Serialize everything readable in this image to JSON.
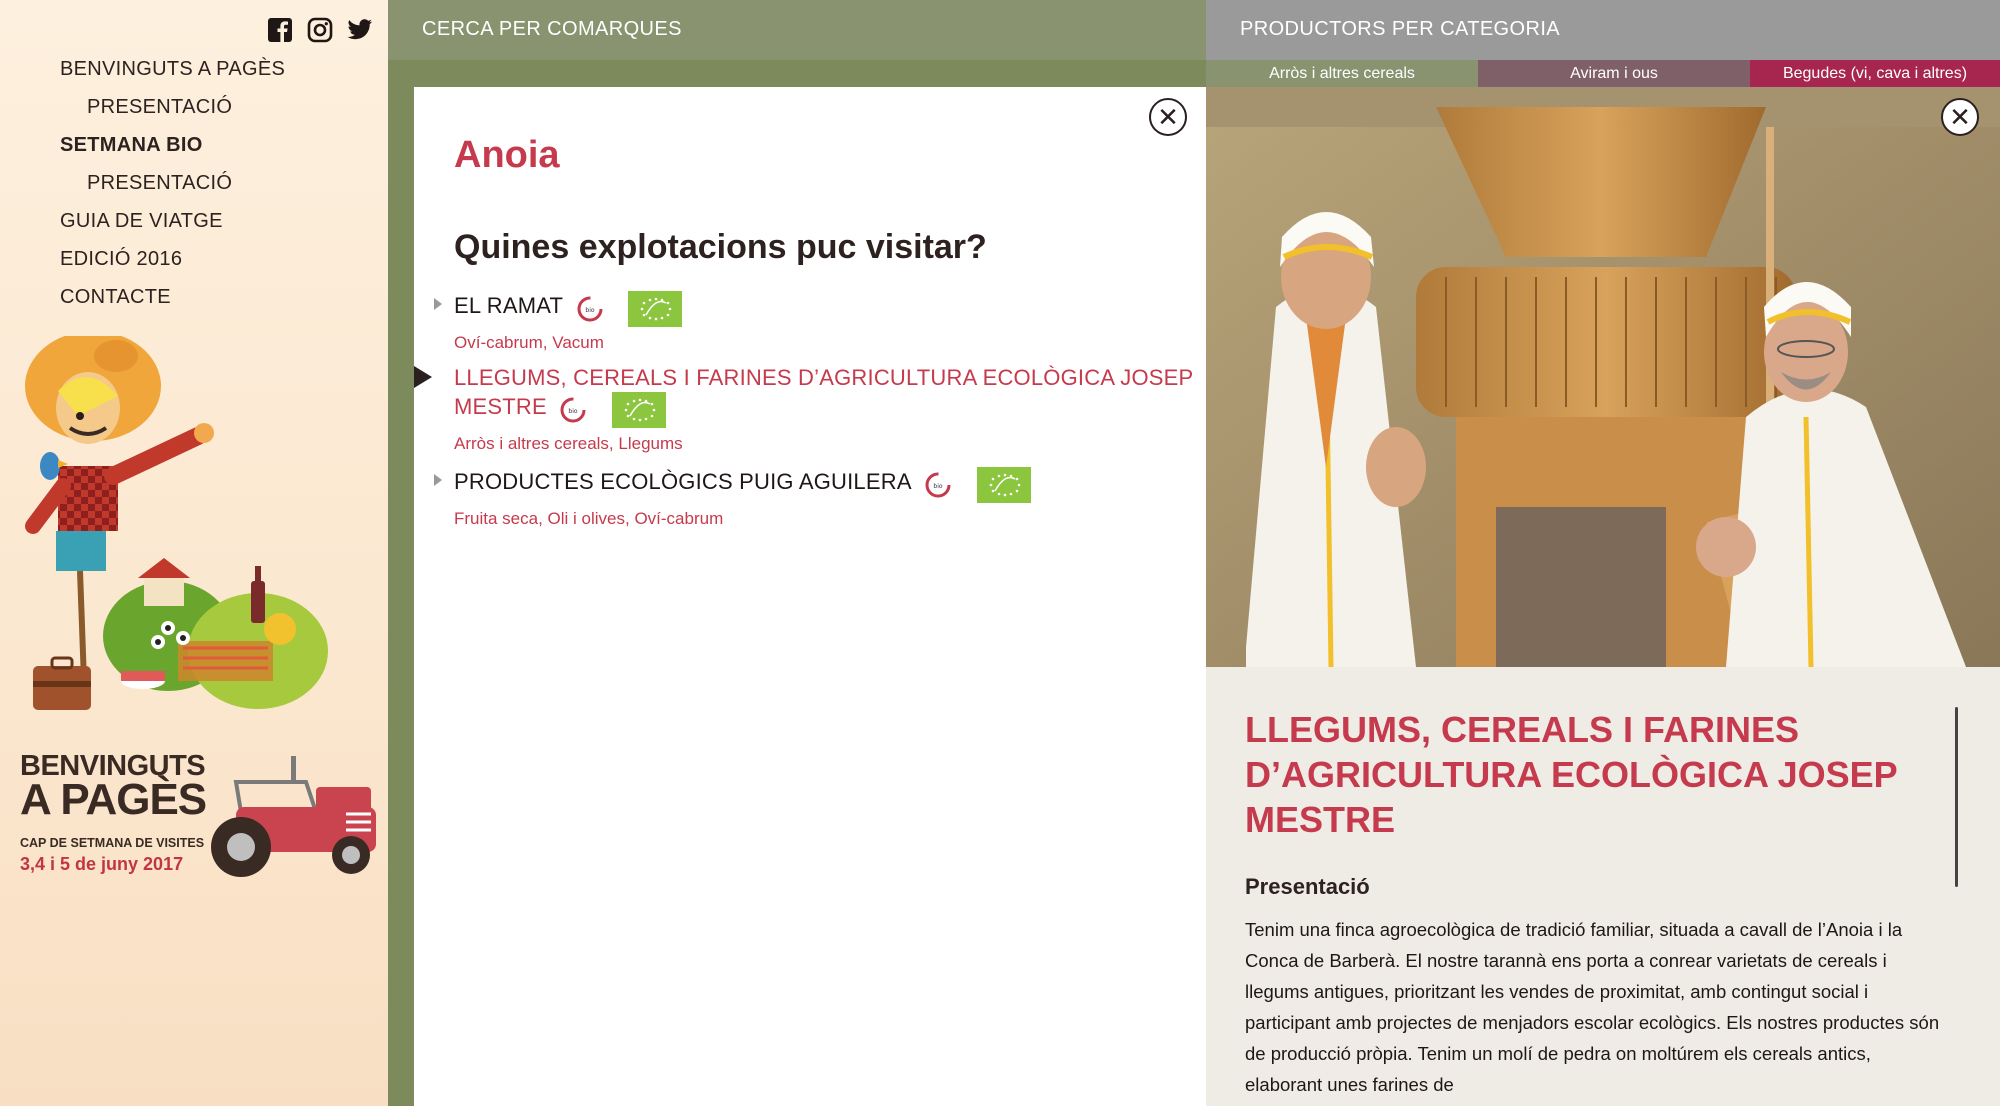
{
  "sidebar": {
    "social": [
      "facebook-icon",
      "instagram-icon",
      "twitter-icon"
    ],
    "nav": [
      {
        "label": "BENVINGUTS A PAGÈS",
        "level": 0
      },
      {
        "label": "PRESENTACIÓ",
        "level": 1
      },
      {
        "label": "SETMANA BIO",
        "level": 0,
        "active": true
      },
      {
        "label": "PRESENTACIÓ",
        "level": 1
      },
      {
        "label": "GUIA DE VIATGE",
        "level": 0
      },
      {
        "label": "EDICIÓ 2016",
        "level": 0
      },
      {
        "label": "CONTACTE",
        "level": 0
      }
    ],
    "logo": {
      "line1": "BENVINGUTS",
      "line2": "A PAGÈS",
      "line3": "CAP DE SETMANA DE VISITES",
      "line4": "3,4 i 5 de juny 2017"
    }
  },
  "topbar": {
    "left_label": "CERCA PER COMARQUES",
    "right_label": "PRODUCTORS PER CATEGORIA"
  },
  "category_tabs": [
    {
      "label": "Arròs i altres cereals",
      "color": "#8a9370"
    },
    {
      "label": "Aviram i ous",
      "color": "#7f5f68"
    },
    {
      "label": "Begudes (vi, cava i altres)",
      "color": "#a7264f"
    }
  ],
  "list_panel": {
    "region": "Anoia",
    "question": "Quines explotacions puc visitar?",
    "farms": [
      {
        "name": "EL RAMAT",
        "categories": "Oví-cabrum, Vacum",
        "selected": false
      },
      {
        "name": "LLEGUMS, CEREALS I FARINES D’AGRICULTURA ECOLÒGICA JOSEP MESTRE",
        "categories": "Arròs i altres cereals, Llegums",
        "selected": true
      },
      {
        "name": "PRODUCTES ECOLÒGICS PUIG AGUILERA",
        "categories": "Fruita seca, Oli i olives, Oví-cabrum",
        "selected": false
      }
    ]
  },
  "detail_panel": {
    "title": "LLEGUMS, CEREALS I FARINES D’AGRICULTURA ECOLÒGICA JOSEP MESTRE",
    "subtitle": "Presentació",
    "text": "Tenim una finca agroecològica de tradició familiar, situada a cavall de l’Anoia i la Conca de Barberà. El nostre tarannà ens porta a conrear varietats de cereals i llegums antigues, prioritzant les vendes de proximitat, amb contingut social i participant amb projectes de menjadors escolar ecològics. Els nostres productes són de producció pròpia. Tenim un molí de pedra on moltúrem els cereals antics, elaborant unes farines de"
  },
  "colors": {
    "accent": "#c53a4c",
    "olive": "#8a9370",
    "eu_green": "#8bc63e"
  }
}
